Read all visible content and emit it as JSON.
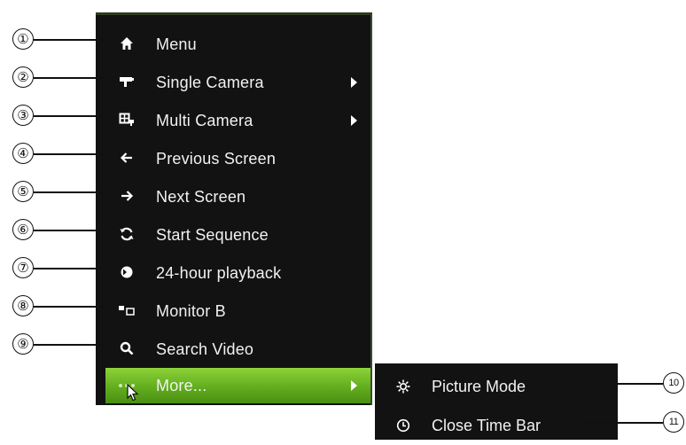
{
  "colors": {
    "menu_background": "#121212",
    "highlight_green": "#62ad1e",
    "text": "#f2f2f2",
    "callout": "#111111"
  },
  "menu": {
    "items": [
      {
        "label": "Menu",
        "icon": "home-icon",
        "callout": "①"
      },
      {
        "label": "Single Camera",
        "icon": "camera-icon",
        "callout": "②",
        "has_submenu": true
      },
      {
        "label": "Multi Camera",
        "icon": "multi-camera-icon",
        "callout": "③",
        "has_submenu": true
      },
      {
        "label": "Previous Screen",
        "icon": "arrow-left-icon",
        "callout": "④"
      },
      {
        "label": "Next Screen",
        "icon": "arrow-right-icon",
        "callout": "⑤"
      },
      {
        "label": "Start Sequence",
        "icon": "refresh-icon",
        "callout": "⑥"
      },
      {
        "label": "24-hour playback",
        "icon": "playback-icon",
        "callout": "⑦"
      },
      {
        "label": "Monitor B",
        "icon": "monitor-icon",
        "callout": "⑧"
      },
      {
        "label": "Search Video",
        "icon": "search-icon",
        "callout": "⑨"
      },
      {
        "label": "More...",
        "icon": "more-dots-icon",
        "has_submenu": true,
        "highlighted": true
      }
    ]
  },
  "submenu": {
    "items": [
      {
        "label": "Picture Mode",
        "icon": "picture-mode-icon",
        "callout": "10"
      },
      {
        "label": "Close Time Bar",
        "icon": "clock-icon",
        "callout": "11"
      }
    ]
  }
}
